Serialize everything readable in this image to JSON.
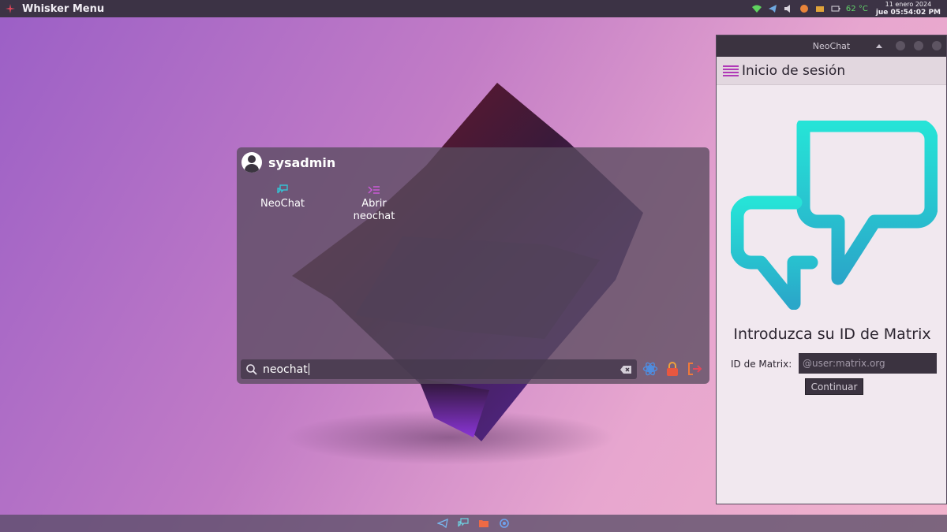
{
  "top_panel": {
    "title": "Whisker Menu",
    "temperature": "62 °C",
    "date": "11 enero 2024",
    "time": "jue 05:54:02 PM"
  },
  "whisker_menu": {
    "username": "sysadmin",
    "results": [
      {
        "label": "NeoChat",
        "icon": "neochat-icon"
      },
      {
        "label": "Abrir neochat",
        "icon": "terminal-action-icon"
      }
    ],
    "search": {
      "value": "neochat"
    },
    "actions": [
      "settings-icon",
      "lock-icon",
      "logout-icon"
    ]
  },
  "neochat_window": {
    "window_title": "NeoChat",
    "header_title": "Inicio de sesión",
    "heading": "Introduzca su ID de Matrix",
    "field_label": "ID de Matrix:",
    "field_placeholder": "@user:matrix.org",
    "continue_label": "Continuar"
  },
  "bottom_panel": {
    "icons": [
      "telegram-icon",
      "neochat-icon",
      "files-icon",
      "debian-icon"
    ]
  },
  "colors": {
    "accent": "#b039b7",
    "neochat_teal": "#27c3cf",
    "panel": "#3c3345"
  }
}
